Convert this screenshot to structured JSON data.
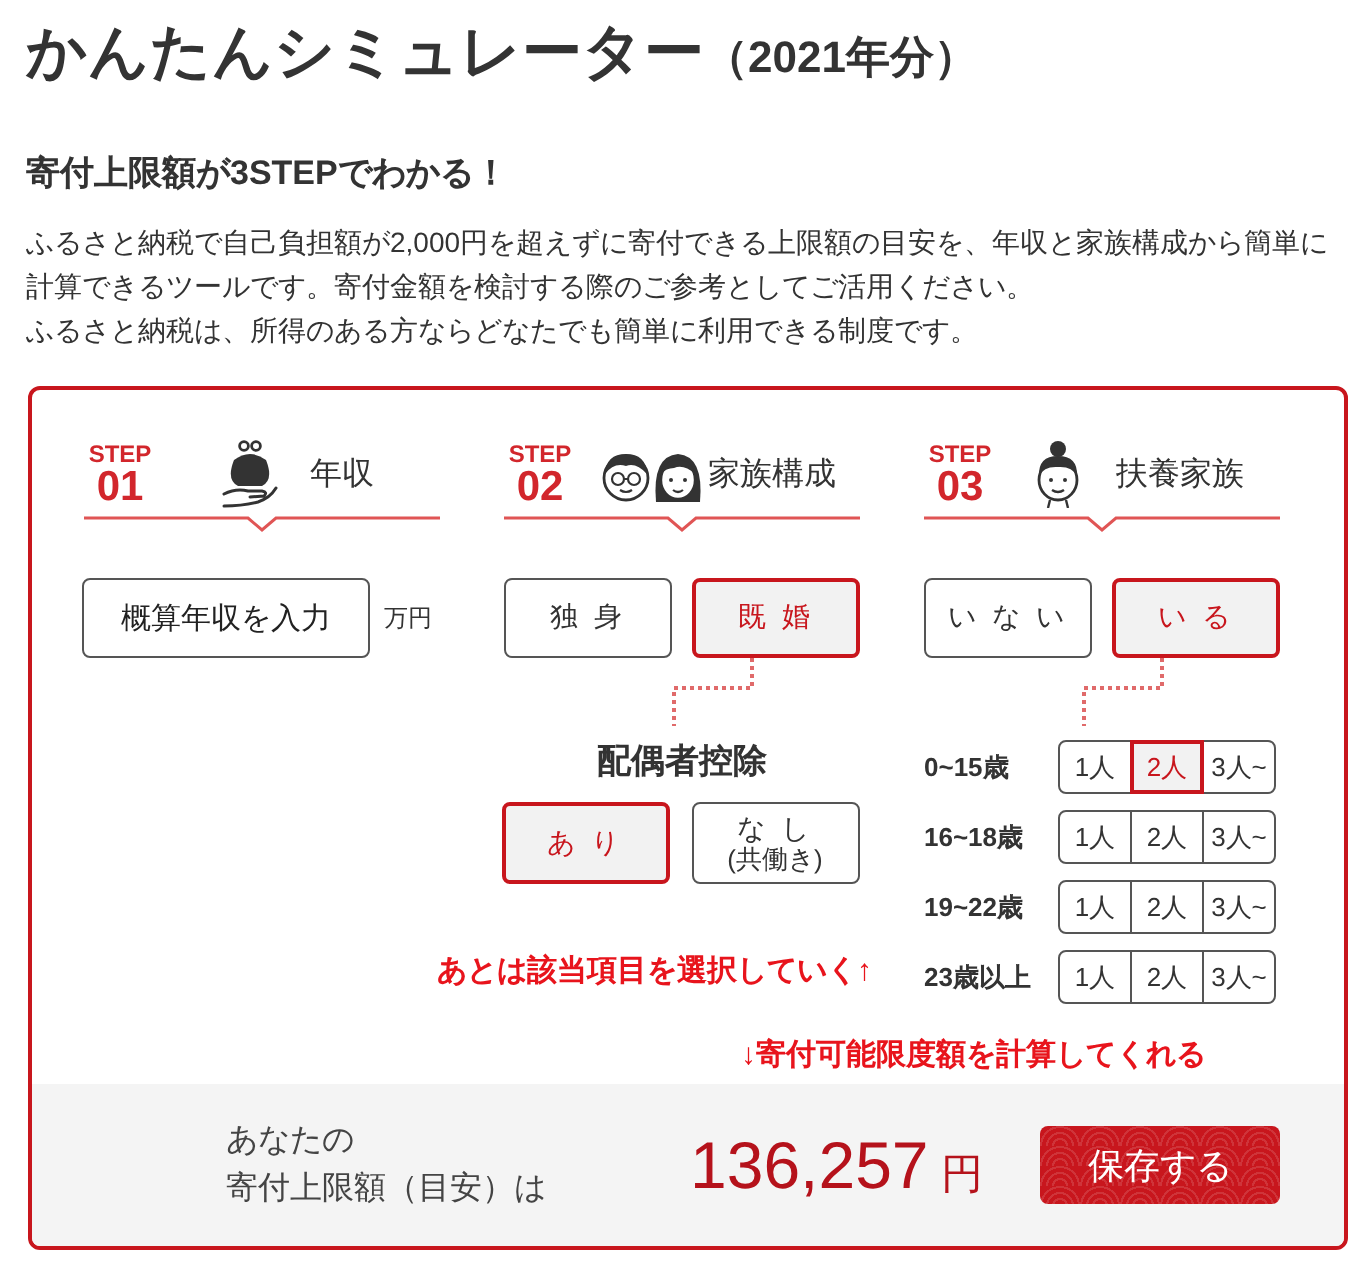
{
  "page_title": {
    "main": "かんたんシミュレーター",
    "year": "（2021年分）"
  },
  "lead": {
    "heading": "寄付上限額が3STEPでわかる！",
    "lines": [
      "ふるさと納税で自己負担額が2,000円を超えずに寄付できる上限額の目安を、年収と家族構成から簡単に",
      "計算できるツールです。寄付金額を検討する際のご参考としてご活用ください。",
      "ふるさと納税は、所得のある方ならどなたでも簡単に利用できる制度です。"
    ]
  },
  "simulator": {
    "steps": [
      {
        "kind": "income",
        "step_label": "STEP",
        "number": "01",
        "title": "年収",
        "input_button": "概算年収を入力",
        "unit": "万円"
      },
      {
        "kind": "family",
        "step_label": "STEP",
        "number": "02",
        "title": "家族構成",
        "options": [
          {
            "label": "独 身",
            "selected": false
          },
          {
            "label": "既 婚",
            "selected": true
          }
        ],
        "sub_section": {
          "title": "配偶者控除",
          "options": [
            {
              "label": "あ り",
              "selected": true
            },
            {
              "label": "な し",
              "note": "(共働き)",
              "selected": false
            }
          ]
        }
      },
      {
        "kind": "dependents",
        "step_label": "STEP",
        "number": "03",
        "title": "扶養家族",
        "options": [
          {
            "label": "い な い",
            "selected": false
          },
          {
            "label": "い る",
            "selected": true
          }
        ],
        "age_groups": [
          {
            "age": "0~15歳",
            "counts": [
              {
                "label": "1人",
                "selected": false
              },
              {
                "label": "2人",
                "selected": true
              },
              {
                "label": "3人~",
                "selected": false
              }
            ]
          },
          {
            "age": "16~18歳",
            "counts": [
              {
                "label": "1人",
                "selected": false
              },
              {
                "label": "2人",
                "selected": false
              },
              {
                "label": "3人~",
                "selected": false
              }
            ]
          },
          {
            "age": "19~22歳",
            "counts": [
              {
                "label": "1人",
                "selected": false
              },
              {
                "label": "2人",
                "selected": false
              },
              {
                "label": "3人~",
                "selected": false
              }
            ]
          },
          {
            "age": "23歳以上",
            "counts": [
              {
                "label": "1人",
                "selected": false
              },
              {
                "label": "2人",
                "selected": false
              },
              {
                "label": "3人~",
                "selected": false
              }
            ]
          }
        ]
      }
    ],
    "annotations": [
      "あとは該当項目を選択していく↑",
      "↓寄付可能限度額を計算してくれる"
    ],
    "result": {
      "label_lines": [
        "あなたの",
        "寄付上限額（目安）は"
      ],
      "amount": "136,257",
      "unit": "円",
      "save_button": "保存する"
    }
  }
}
